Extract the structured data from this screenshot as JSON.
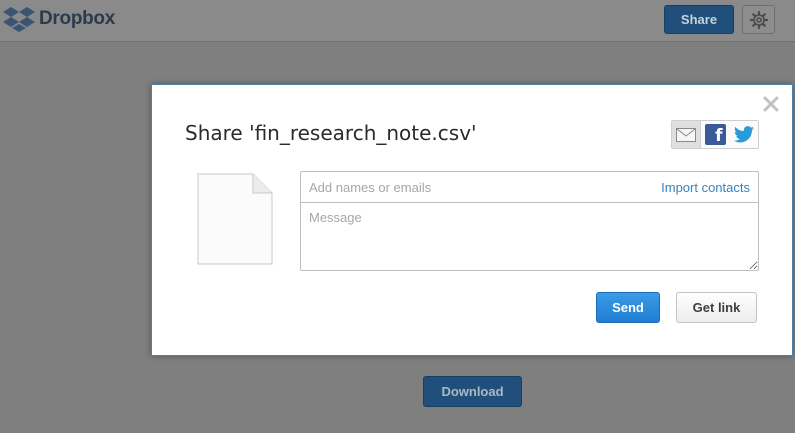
{
  "app": {
    "name": "Dropbox"
  },
  "header": {
    "share_label": "Share",
    "settings_icon": "gear-icon",
    "logo_icon": "dropbox-logo-icon"
  },
  "page": {
    "download_label": "Download"
  },
  "dialog": {
    "title": "Share 'fin_research_note.csv'",
    "close_icon": "close-icon",
    "social": [
      "email-icon",
      "facebook-icon",
      "twitter-icon"
    ],
    "facebook_glyph": "f",
    "file_icon": "document-icon",
    "recipients": {
      "value": "",
      "placeholder": "Add names or emails"
    },
    "import_contacts_label": "Import contacts",
    "message": {
      "value": "",
      "placeholder": "Message"
    },
    "send_label": "Send",
    "get_link_label": "Get link"
  },
  "colors": {
    "overlay": "#7f7f7f",
    "primary_button": "#1f7ed2",
    "link": "#3b7fc4",
    "facebook": "#3b5b98",
    "twitter": "#2a9ad9"
  }
}
